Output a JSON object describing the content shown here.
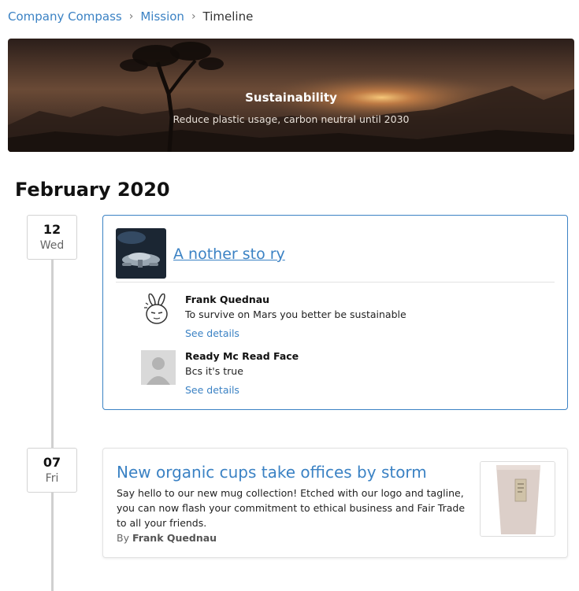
{
  "breadcrumb": {
    "items": [
      "Company Compass",
      "Mission"
    ],
    "current": "Timeline"
  },
  "hero": {
    "title": "Sustainability",
    "subtitle": "Reduce plastic usage, carbon neutral until 2030"
  },
  "month": "February 2020",
  "entries": [
    {
      "day": "12",
      "weekday": "Wed",
      "story_title": "A nother sto ry",
      "comments": [
        {
          "author": "Frank Quednau",
          "text": "To survive on Mars you better be sustainable",
          "link": "See details"
        },
        {
          "author": "Ready Mc Read Face",
          "text": "Bcs it's true",
          "link": "See details"
        }
      ]
    },
    {
      "day": "07",
      "weekday": "Fri",
      "title": "New organic cups take offices by storm",
      "body": "Say hello to our new mug collection! Etched with our logo and tagline, you can now flash your commitment to ethical business and Fair Trade to all your friends.",
      "by_prefix": "By",
      "author": "Frank Quednau"
    }
  ],
  "colors": {
    "link": "#3b82c4",
    "card_border_active": "#3b82c4"
  }
}
